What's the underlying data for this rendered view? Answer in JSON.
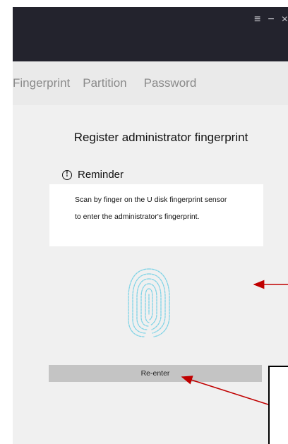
{
  "window": {
    "controls": {
      "menu": "≡",
      "minimize": "−",
      "close": "×"
    }
  },
  "tabs": [
    {
      "label": "Fingerprint"
    },
    {
      "label": "Partition"
    },
    {
      "label": "Password"
    }
  ],
  "main": {
    "title": "Register administrator fingerprint",
    "reminder_label": "Reminder",
    "reminder_line1": "Scan by finger on the U disk fingerprint sensor",
    "reminder_line2": "to enter the administrator's fingerprint.",
    "reenter_label": "Re-enter"
  },
  "colors": {
    "titlebar": "#23232d",
    "fingerprint": "#7fd3e6",
    "annotation_arrow": "#c00000"
  },
  "icons": {
    "info": "info-circle-icon",
    "fingerprint": "fingerprint-icon"
  }
}
